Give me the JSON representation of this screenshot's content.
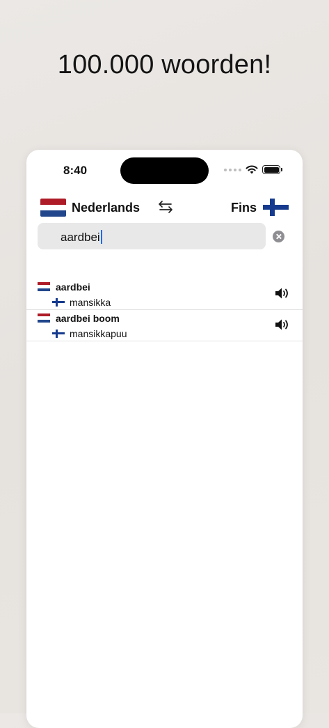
{
  "headline": "100.000 woorden!",
  "status": {
    "time": "8:40"
  },
  "languages": {
    "from": "Nederlands",
    "to": "Fins"
  },
  "search": {
    "value": "aardbei"
  },
  "results": [
    {
      "word": "aardbei",
      "translation": "mansikka"
    },
    {
      "word": "aardbei boom",
      "translation": "mansikkapuu"
    }
  ],
  "colors": {
    "nl_red": "#ae1c28",
    "nl_blue": "#21468b",
    "fi_blue": "#163b8e",
    "caret": "#1a6cf0"
  }
}
